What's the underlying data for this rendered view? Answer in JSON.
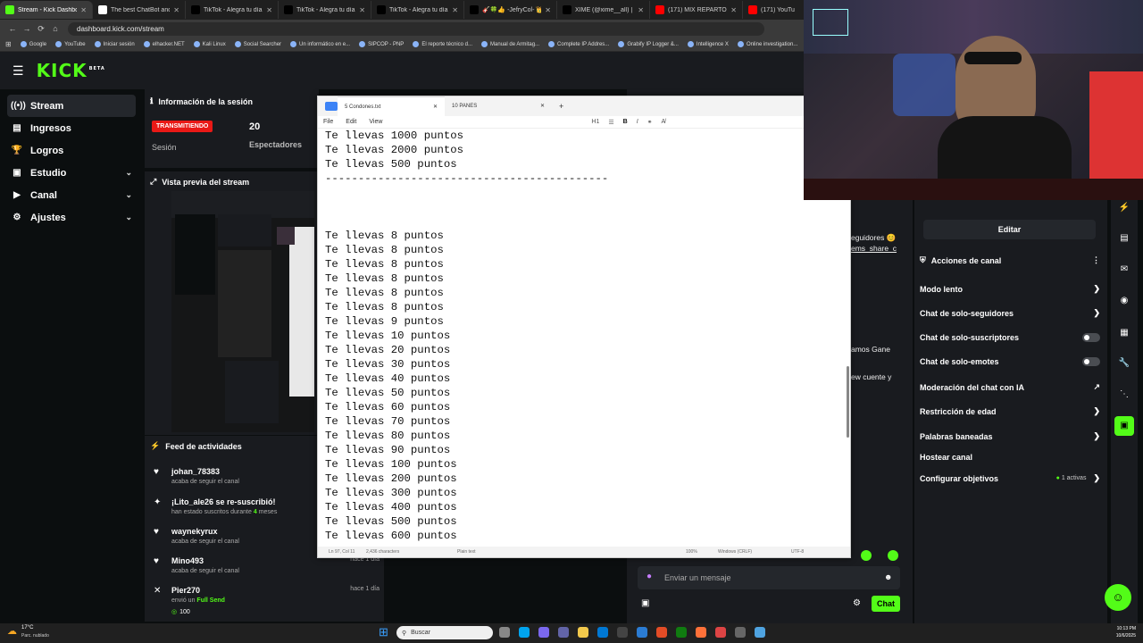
{
  "browser": {
    "tabs": [
      {
        "title": "Stream - Kick Dashboard",
        "active": true,
        "color": "#53fc18"
      },
      {
        "title": "The best ChatBot and Wi",
        "active": false,
        "color": "#ffffff"
      },
      {
        "title": "TikTok - Alegra tu día",
        "active": false,
        "color": "#000000"
      },
      {
        "title": "TikTok - Alegra tu día",
        "active": false,
        "color": "#000000"
      },
      {
        "title": "TikTok - Alegra tu día",
        "active": false,
        "color": "#000000"
      },
      {
        "title": "🎸🍀👍 -JefryCol- 👑🍀🎸",
        "active": false,
        "color": "#000000"
      },
      {
        "title": "XIME (@xime__all) | TikTok",
        "active": false,
        "color": "#000000"
      },
      {
        "title": "(171) MIX REPARTO 20",
        "active": false,
        "color": "#ff0000"
      },
      {
        "title": "(171) YouTu",
        "active": false,
        "color": "#ff0000"
      }
    ],
    "url": "dashboard.kick.com/stream",
    "bookmarks": [
      "Google",
      "YouTube",
      "Iniciar sesión",
      "elhacker.NET",
      "Kali Linux",
      "Social Searcher",
      "Un informático en e...",
      "SIPCOP - PNP",
      "El reporte técnico d...",
      "Manual de Armitag...",
      "Complete IP Addres...",
      "Grabify IP Logger &...",
      "Intelligence X",
      "Online investigation..."
    ]
  },
  "kick": {
    "logo": "KICK",
    "logo_sup": "BETA",
    "brand_color": "#53fc18",
    "sidebar": [
      {
        "label": "Stream",
        "icon": "antenna-icon",
        "glyph": "((•))",
        "chevron": false,
        "active": true
      },
      {
        "label": "Ingresos",
        "icon": "money-icon",
        "glyph": "▤",
        "chevron": false,
        "active": false
      },
      {
        "label": "Logros",
        "icon": "trophy-icon",
        "glyph": "🏆",
        "chevron": false,
        "active": false
      },
      {
        "label": "Estudio",
        "icon": "studio-icon",
        "glyph": "▣",
        "chevron": true,
        "active": false
      },
      {
        "label": "Canal",
        "icon": "channel-icon",
        "glyph": "▶",
        "chevron": true,
        "active": false
      },
      {
        "label": "Ajustes",
        "icon": "gear-icon",
        "glyph": "⚙",
        "chevron": true,
        "active": false
      }
    ],
    "session": {
      "title": "Información de la sesión",
      "badge": "TRANSMITIENDO",
      "session_label": "Sesión",
      "viewers_value": "20",
      "viewers_label": "Espectadores"
    },
    "preview": {
      "title": "Vista previa del stream"
    },
    "feed": {
      "title": "Feed de actividades",
      "items": [
        {
          "icon": "heart-icon",
          "glyph": "♥",
          "name": "johan_78383",
          "sub": "acaba de seguir el canal",
          "time": ""
        },
        {
          "icon": "star-icon",
          "glyph": "✦",
          "name": "¡Lito_ale26 se re-suscribió!",
          "sub": "han estado suscritos durante",
          "sub_highlight": "4",
          "sub_end": "meses",
          "time": ""
        },
        {
          "icon": "heart-icon",
          "glyph": "♥",
          "name": "waynekyrux",
          "sub": "acaba de seguir el canal",
          "time": ""
        },
        {
          "icon": "heart-icon",
          "glyph": "♥",
          "name": "Mino493",
          "sub": "acaba de seguir el canal",
          "time": "hace 1 día"
        },
        {
          "icon": "close-circle-icon",
          "glyph": "✕",
          "name": "Pier270",
          "sub": "envió un",
          "sub_highlight": "Full Send",
          "amount": "100",
          "time": "hace 1 día"
        }
      ]
    },
    "chat": {
      "partial_lines": [
        "eguidores 😊",
        "ems_share_c",
        "amos Gane",
        "ew cuente y"
      ],
      "placeholder": "Enviar un mensaje",
      "send_label": "Chat"
    },
    "channel_actions": {
      "edit_label": "Editar",
      "title": "Acciones de canal",
      "items": [
        {
          "label": "Modo lento",
          "control": "chevron"
        },
        {
          "label": "Chat de solo-seguidores",
          "control": "chevron"
        },
        {
          "label": "Chat de solo-suscriptores",
          "control": "toggle"
        },
        {
          "label": "Chat de solo-emotes",
          "control": "toggle"
        },
        {
          "label": "Moderación del chat con IA",
          "control": "external"
        },
        {
          "label": "Restricción de edad",
          "control": "chevron"
        },
        {
          "label": "Palabras baneadas",
          "control": "chevron"
        },
        {
          "label": "Hostear canal",
          "control": "none"
        },
        {
          "label": "Configurar objetivos",
          "control": "chevron",
          "extra": "1 activas"
        }
      ]
    }
  },
  "notepad": {
    "tabs": [
      "5 Condones.txt",
      "10 PANES"
    ],
    "menu": [
      "File",
      "Edit",
      "View"
    ],
    "heading_tool": "H1",
    "lines": [
      "Te llevas 1000 puntos",
      "Te llevas 2000 puntos",
      "Te llevas 500 puntos",
      "-------------------------------------------",
      "",
      "",
      "",
      "Te llevas 8 puntos",
      "Te llevas 8 puntos",
      "Te llevas 8 puntos",
      "Te llevas 8 puntos",
      "Te llevas 8 puntos",
      "Te llevas 8 puntos",
      "Te llevas 9 puntos",
      "Te llevas 10 puntos",
      "Te llevas 20 puntos",
      "Te llevas 30 puntos",
      "Te llevas 40 puntos",
      "Te llevas 50 puntos",
      "Te llevas 60 puntos",
      "Te llevas 70 puntos",
      "Te llevas 80 puntos",
      "Te llevas 90 puntos",
      "Te llevas 100 puntos",
      "Te llevas 200 puntos",
      "Te llevas 300 puntos",
      "Te llevas 400 puntos",
      "Te llevas 500 puntos",
      "Te llevas 600 puntos"
    ],
    "status": {
      "position": "Ln 97, Col 11",
      "chars": "2,436 characters",
      "format": "Plain text",
      "zoom": "100%",
      "eol": "Windows (CRLF)",
      "encoding": "UTF-8"
    }
  },
  "taskbar": {
    "weather_temp": "17°C",
    "weather_desc": "Parc. nublado",
    "search_placeholder": "Buscar",
    "time": "10:13 PM",
    "date": "10/6/2025"
  }
}
